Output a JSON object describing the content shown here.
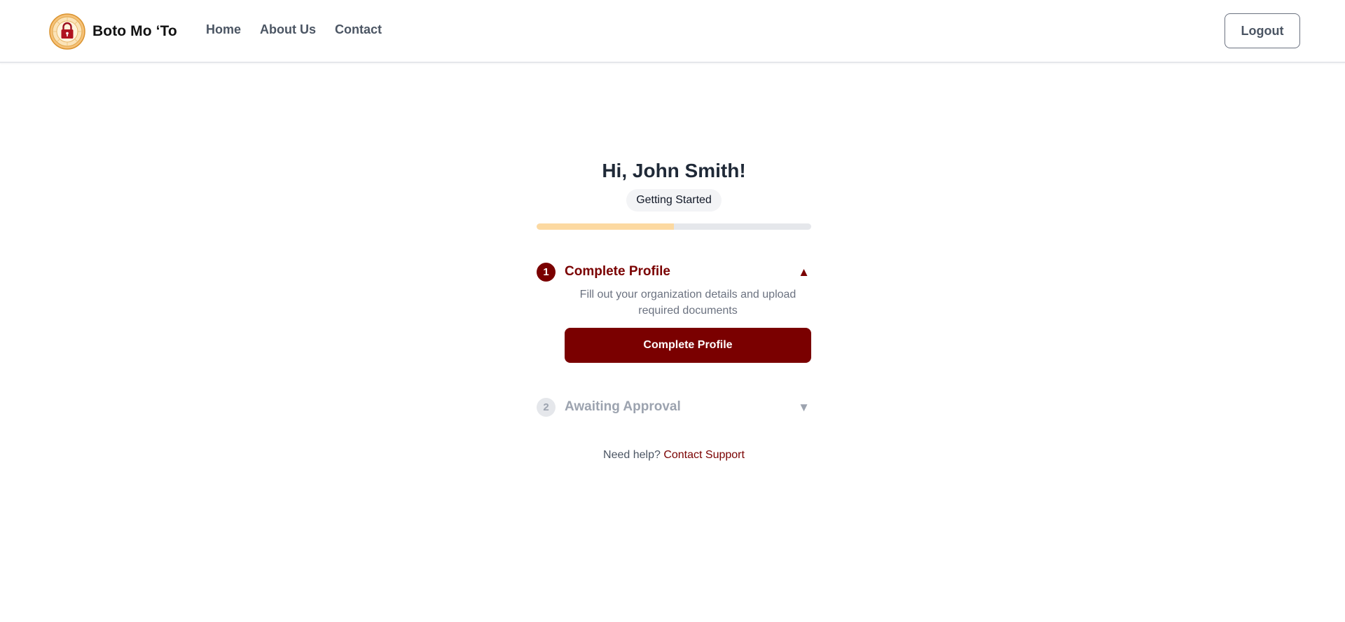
{
  "header": {
    "brand_name": "Boto Mo ‘To",
    "logo_icon": "padlock-seal-icon",
    "nav": [
      {
        "label": "Home"
      },
      {
        "label": "About Us"
      },
      {
        "label": "Contact"
      }
    ],
    "logout_label": "Logout"
  },
  "main": {
    "greeting": "Hi, John Smith!",
    "status_badge": "Getting Started",
    "progress_fraction": 0.5,
    "steps": [
      {
        "number": "1",
        "title": "Complete Profile",
        "toggle": "▲",
        "expanded": true,
        "description": "Fill out your organization details and upload required documents",
        "action_label": "Complete Profile"
      },
      {
        "number": "2",
        "title": "Awaiting Approval",
        "toggle": "▼",
        "expanded": false
      }
    ],
    "help": {
      "prefix": "Need help?",
      "link": "Contact Support"
    }
  },
  "colors": {
    "brand": "#7a0000",
    "progress": "#fcd9a1",
    "track": "#e5e7eb",
    "muted": "#9ca3af"
  }
}
